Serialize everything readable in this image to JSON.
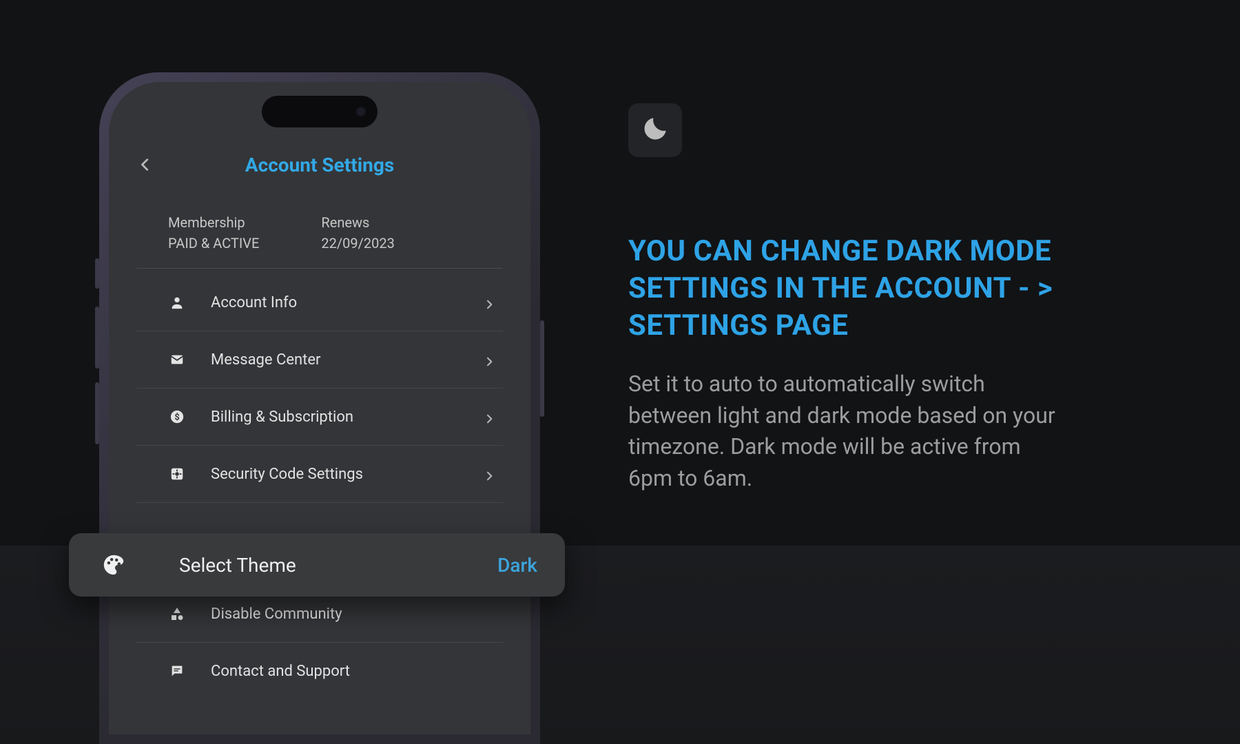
{
  "colors": {
    "accent": "#2ea3e6",
    "phone_bg": "#343538",
    "page_bg": "#121315"
  },
  "phone": {
    "title": "Account Settings",
    "membership": {
      "label": "Membership",
      "value": "PAID & ACTIVE"
    },
    "renews": {
      "label": "Renews",
      "value": "22/09/2023"
    },
    "items": [
      {
        "icon": "person-icon",
        "label": "Account Info",
        "chevron": true
      },
      {
        "icon": "mail-icon",
        "label": "Message Center",
        "chevron": true
      },
      {
        "icon": "dollar-icon",
        "label": "Billing & Subscription",
        "chevron": true
      },
      {
        "icon": "gear-box-icon",
        "label": "Security Code Settings",
        "chevron": true
      },
      {
        "icon": "palette-icon",
        "label": "Select Theme",
        "chevron": false
      },
      {
        "icon": "shapes-icon",
        "label": "Disable Community",
        "chevron": false
      },
      {
        "icon": "chat-icon",
        "label": "Contact and Support",
        "chevron": false
      }
    ]
  },
  "theme_popover": {
    "icon": "palette-icon",
    "label": "Select Theme",
    "value": "Dark"
  },
  "callout": {
    "icon": "moon-icon",
    "heading": "YOU CAN CHANGE  DARK MODE SETTINGS IN THE ACCOUNT - > SETTINGS PAGE",
    "body": "Set it to auto to automatically switch between light and dark mode based on your timezone. Dark mode will be active from 6pm to 6am."
  }
}
